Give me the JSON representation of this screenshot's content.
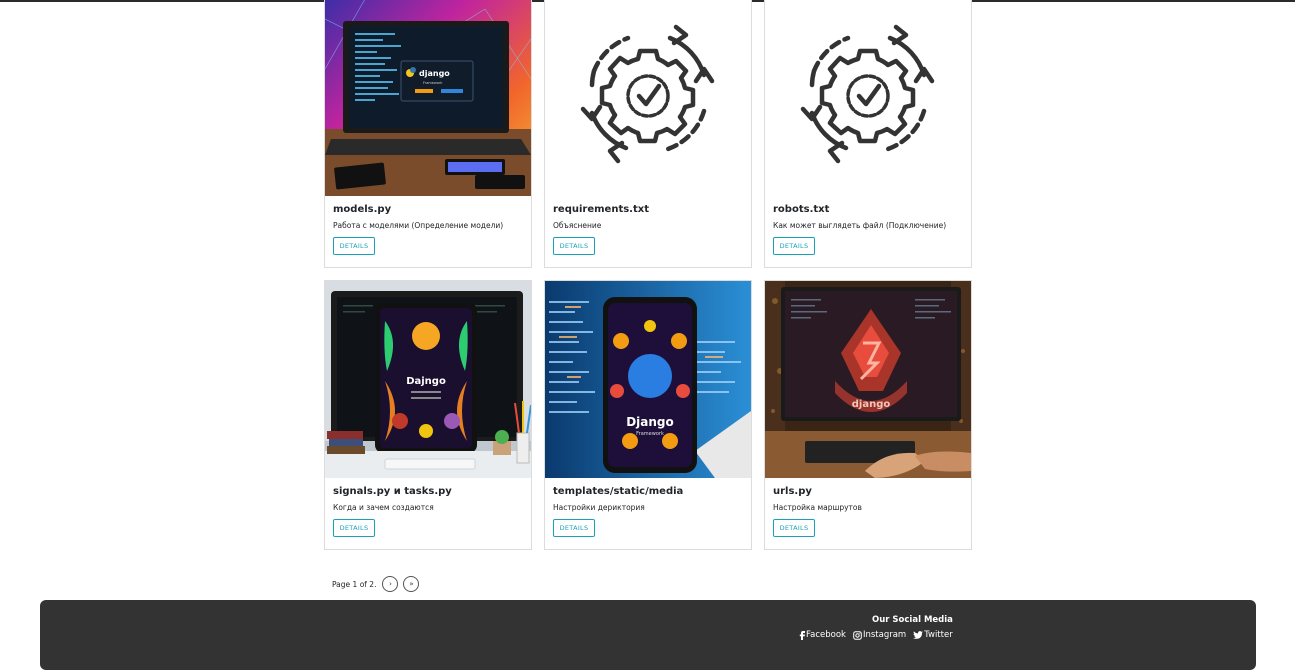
{
  "cards": [
    {
      "title": "models.py",
      "text": "Работа с моделями (Определение модели)",
      "button": "DETAILS",
      "image": "django-laptop-illustration",
      "overlay_text": [
        "django",
        "Framework"
      ]
    },
    {
      "title": "requirements.txt",
      "text": "Объяснение",
      "button": "DETAILS",
      "image": "gear-check-icon"
    },
    {
      "title": "robots.txt",
      "text": "Как может выглядеть файл (Подключение)",
      "button": "DETAILS",
      "image": "gear-check-icon"
    },
    {
      "title": "signals.py и tasks.py",
      "text": "Когда и зачем создаются",
      "button": "DETAILS",
      "image": "django-tablet-illustration",
      "overlay_text": [
        "Dajngo"
      ]
    },
    {
      "title": "templates/static/media",
      "text": "Настройки дериктория",
      "button": "DETAILS",
      "image": "django-phone-illustration",
      "overlay_text": [
        "Django",
        "Framework"
      ]
    },
    {
      "title": "urls.py",
      "text": "Настройка маршрутов",
      "button": "DETAILS",
      "image": "django-monitor-illustration",
      "overlay_text": [
        "django"
      ]
    }
  ],
  "pagination": {
    "text": "Page 1 of 2.",
    "next_label": "›",
    "last_label": "»"
  },
  "footer": {
    "social_title": "Our Social Media",
    "links": [
      {
        "label": "Facebook",
        "icon": "facebook-icon"
      },
      {
        "label": "Instagram",
        "icon": "instagram-icon"
      },
      {
        "label": "Twitter",
        "icon": "twitter-icon"
      }
    ]
  },
  "colors": {
    "accent": "#17a2b8",
    "footer_bg": "#333333",
    "card_border": "#dcdcdc"
  }
}
